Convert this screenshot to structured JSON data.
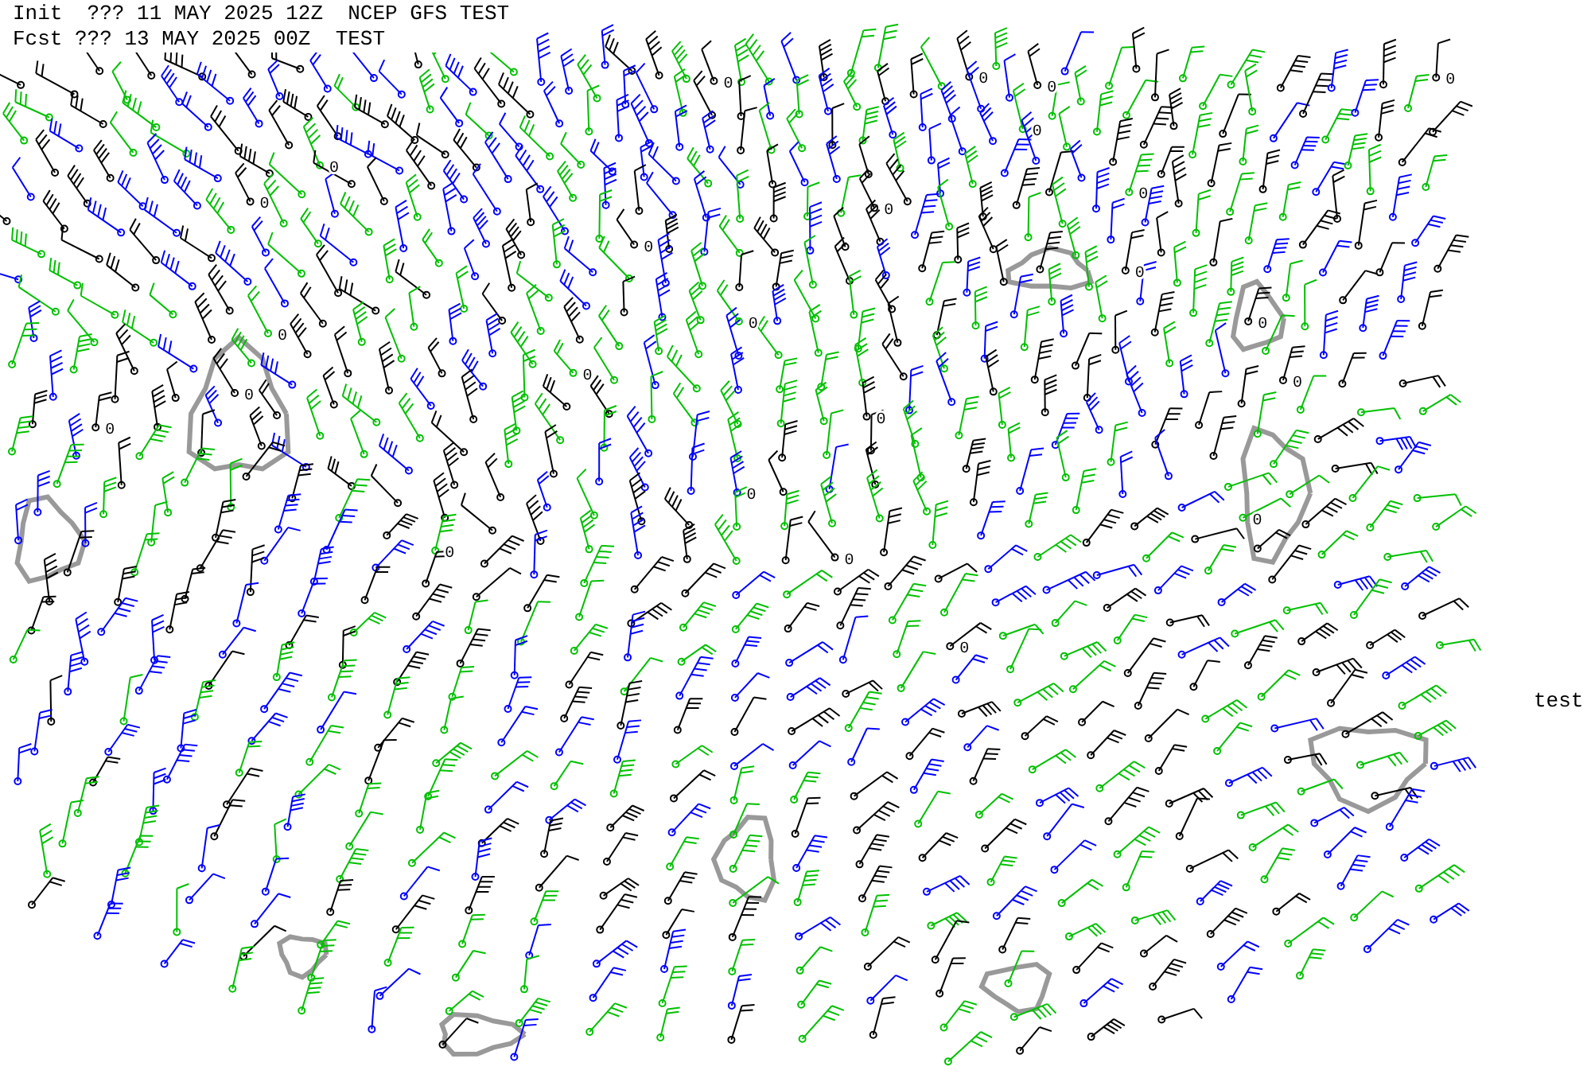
{
  "header": {
    "init_line": "Init  ??? 11 MAY 2025 12Z  NCEP GFS TEST",
    "forecast_line": "Fcst ??? 13 MAY 2025 00Z  TEST"
  },
  "map": {
    "contour_labels": [
      "0",
      "0",
      "0",
      "0",
      "0",
      "0",
      "0",
      "0",
      "0",
      "0",
      "0",
      "0",
      "0",
      "0",
      "0",
      "0",
      "0",
      "0",
      "0",
      "0",
      "0",
      "0",
      "0",
      "0"
    ]
  },
  "side_label": "test"
}
